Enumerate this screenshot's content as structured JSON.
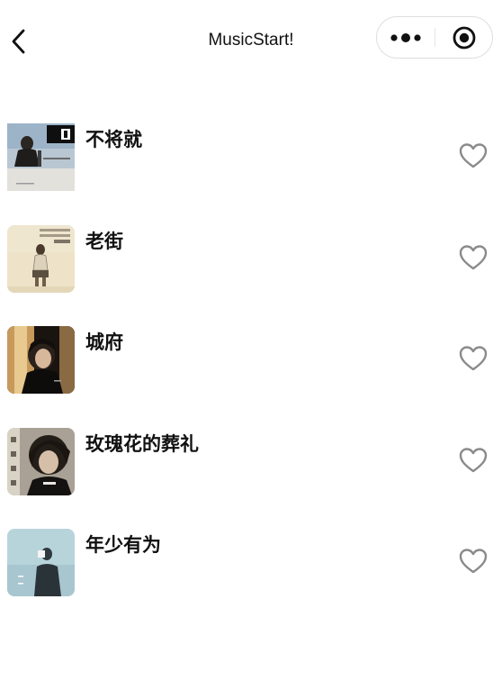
{
  "nav": {
    "title": "MusicStart!",
    "back_icon": "chevron-left-icon",
    "more_icon": "more-dots-icon",
    "close_icon": "target-icon"
  },
  "songs": [
    {
      "title": "不将就",
      "cover_icon": "album-cover-image",
      "favorite_icon": "heart-outline-icon",
      "favorited": false
    },
    {
      "title": "老街",
      "cover_icon": "album-cover-image",
      "favorite_icon": "heart-outline-icon",
      "favorited": false
    },
    {
      "title": "城府",
      "cover_icon": "album-cover-image",
      "favorite_icon": "heart-outline-icon",
      "favorited": false
    },
    {
      "title": "玫瑰花的葬礼",
      "cover_icon": "album-cover-image",
      "favorite_icon": "heart-outline-icon",
      "favorited": false
    },
    {
      "title": "年少有为",
      "cover_icon": "album-cover-image",
      "favorite_icon": "heart-outline-icon",
      "favorited": false
    }
  ],
  "colors": {
    "background": "#ffffff",
    "text": "#111111",
    "heart_stroke": "#8a8a8a",
    "capsule_border": "#dedede"
  }
}
